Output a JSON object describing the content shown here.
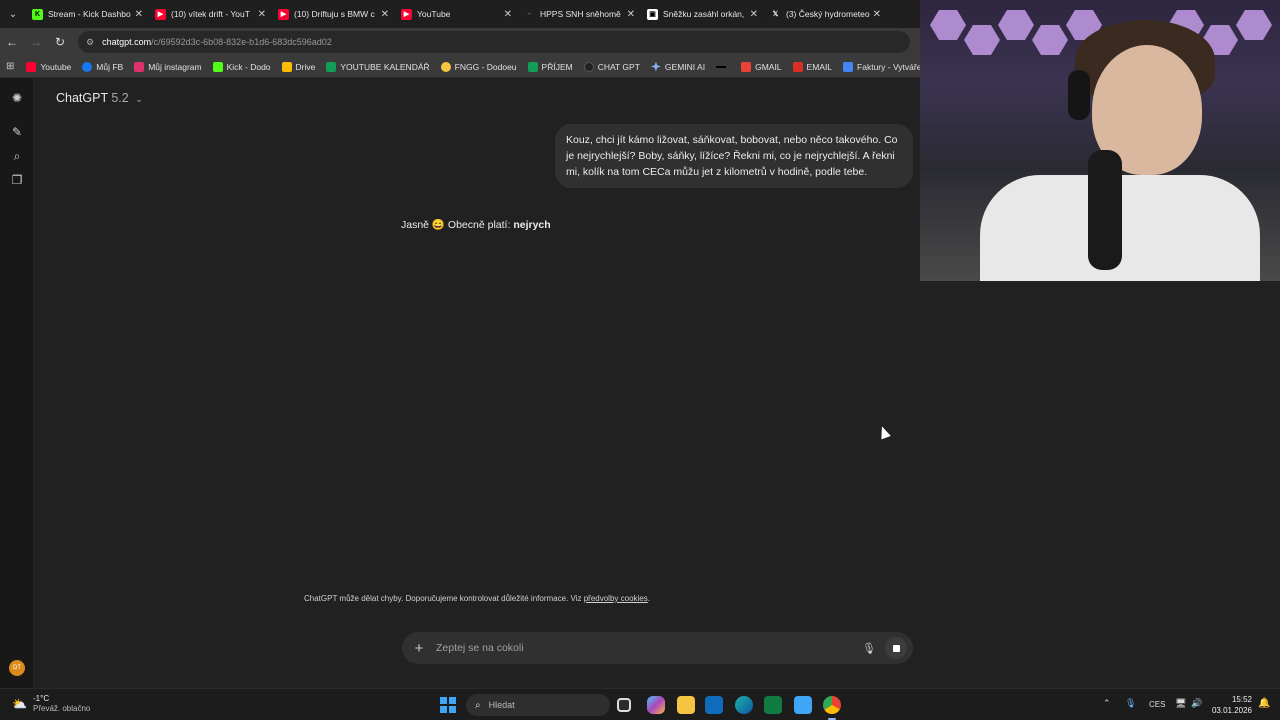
{
  "browser": {
    "tabs": [
      {
        "title": "Stream - Kick Dashbo",
        "icon": "kick-icon",
        "color": "#53fc18"
      },
      {
        "title": "(10) vítek drift - YouT",
        "icon": "youtube-icon",
        "color": "#ff0033"
      },
      {
        "title": "(10) Driftuju s BMW c",
        "icon": "youtube-icon",
        "color": "#ff0033"
      },
      {
        "title": "YouTube",
        "icon": "youtube-icon",
        "color": "#ff0033"
      },
      {
        "title": "HPPS SNH sněhomě",
        "icon": "dash-icon",
        "color": "#555555"
      },
      {
        "title": "Sněžku zasáhl orkán,",
        "icon": "news-icon",
        "color": "#ffffff"
      },
      {
        "title": "(3) Český hydrometeo",
        "icon": "x-icon",
        "color": "#000000"
      }
    ],
    "back_icon": "←",
    "forward_icon": "→",
    "reload_icon": "↻",
    "url_host": "chatgpt.com",
    "url_path": "/c/69592d3c-6b08-832e-b1d6-683dc596ad02",
    "bookmarks": [
      {
        "label": "Youtube",
        "color": "#ff0033"
      },
      {
        "label": "Můj FB",
        "color": "#1877f2"
      },
      {
        "label": "Můj instagram",
        "color": "#e1306c"
      },
      {
        "label": "Kick - Dodo",
        "color": "#53fc18"
      },
      {
        "label": "Drive",
        "color": "#fbbc04"
      },
      {
        "label": "YOUTUBE KALENDÁŘ",
        "color": "#0f9d58"
      },
      {
        "label": "FNGG - Dodoeu",
        "color": "#f5c542"
      },
      {
        "label": "PŘÍJEM",
        "color": "#0f9d58"
      },
      {
        "label": "CHAT GPT",
        "color": "#222222"
      },
      {
        "label": "GEMINI AI",
        "color": "#8ab4f8"
      },
      {
        "label": "",
        "color": "#000000"
      },
      {
        "label": "GMAIL",
        "color": "#ea4335"
      },
      {
        "label": "EMAIL",
        "color": "#d93025"
      },
      {
        "label": "Faktury - Vytváření",
        "color": "#4285f4"
      }
    ]
  },
  "chat": {
    "model_name": "ChatGPT",
    "model_version": "5.2",
    "user_message": "Kouz, chci jít kámo ližovat, sáňkovat, bobovat, nebo něco takového. Co je nejrychlejší? Boby, sáňky, lížíce? Řekni mi, co je nejrychlejší. A řekni mi, kolík na tom CECa můžu jet z kilometrů v hodině, podle tebe.",
    "reply_prefix": "Jasně 😄 Obecně platí: ",
    "reply_bold": "nejrych",
    "composer_placeholder": "Zeptej se na cokoli",
    "disclaimer_text": "ChatGPT může dělat chyby. Doporučujeme kontrolovat důležité informace. Viz ",
    "disclaimer_link": "předvolby cookies",
    "disclaimer_end": ".",
    "avatar_initials": "DT"
  },
  "taskbar": {
    "temperature": "-1°C",
    "weather": "Převáž. oblačno",
    "search_placeholder": "Hledat",
    "language": "CES",
    "time": "15:52",
    "date": "03.01.2026"
  }
}
